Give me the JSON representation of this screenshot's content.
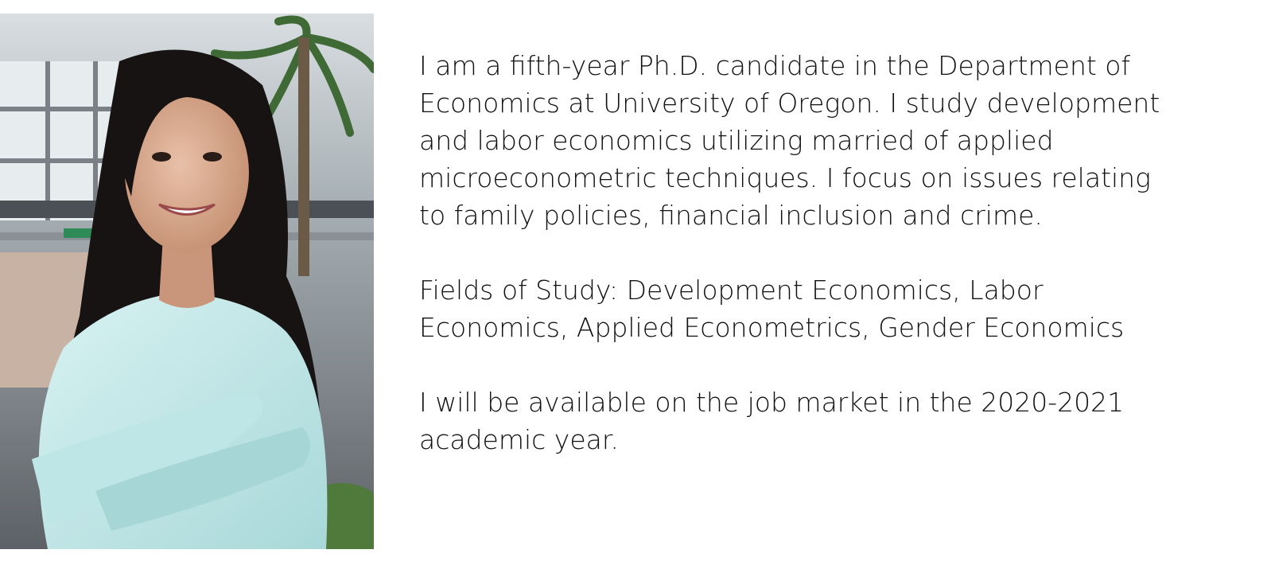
{
  "profile": {
    "photo_alt": "Portrait photo",
    "bio": "I am a fifth-year Ph.D. candidate in the Department of\nEconomics at University of Oregon. I study development\nand labor economics utilizing married of applied\nmicroeconometric techniques. I focus on issues relating\nto family policies, financial inclusion and crime.",
    "fields": "Fields of Study: Development Economics, Labor\nEconomics, Applied Econometrics, Gender Economics",
    "availability": "I will be available on the job market in the 2020-2021\nacademic year."
  }
}
